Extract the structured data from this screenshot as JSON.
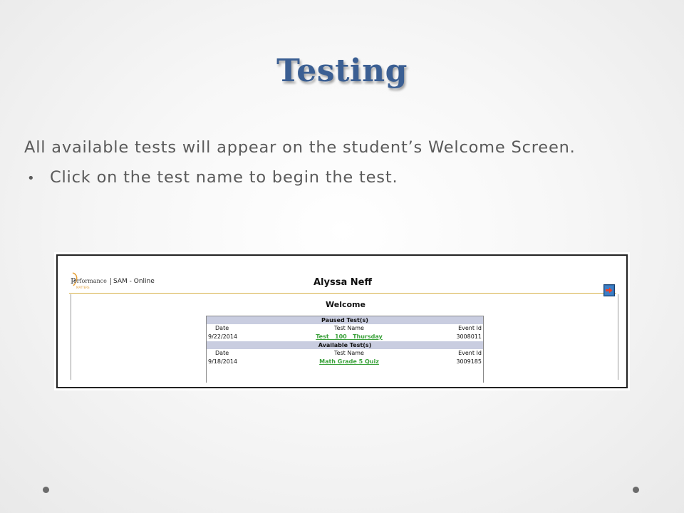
{
  "slide": {
    "title": "Testing",
    "line1": "All available tests will appear on the student’s Welcome Screen.",
    "bullet": "•",
    "line2": "Click on the test name to begin the test."
  },
  "app": {
    "logo_text": "erformance",
    "logo_sub": "MATTERS",
    "name": "SAM - Online",
    "user": "Alyssa Neff",
    "welcome": "Welcome",
    "exit_icon": "exit-arrow-icon"
  },
  "tests": {
    "paused_heading": "Paused Test(s)",
    "available_heading": "Available Test(s)",
    "columns": [
      "Date",
      "Test Name",
      "Event Id"
    ],
    "paused": [
      {
        "date": "9/22/2014",
        "name": "Test   100   Thursday",
        "event_id": "3008011"
      }
    ],
    "available": [
      {
        "date": "9/18/2014",
        "name": "Math Grade 5 Quiz",
        "event_id": "3009185"
      }
    ]
  },
  "colors": {
    "title": "#3b5f93",
    "link": "#3aa13a",
    "section_bg": "#c9cde0"
  }
}
